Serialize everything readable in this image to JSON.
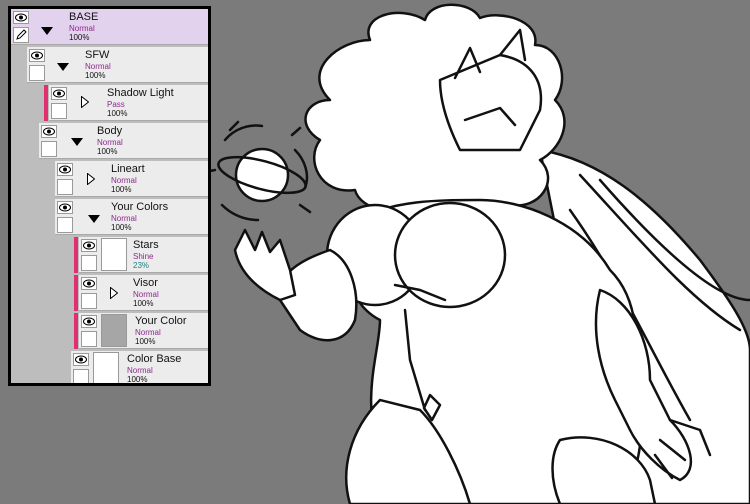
{
  "layers": [
    {
      "name": "BASE",
      "mode": "Normal",
      "opacity": "100%"
    },
    {
      "name": "SFW",
      "mode": "Normal",
      "opacity": "100%"
    },
    {
      "name": "Shadow Light",
      "mode": "Pass",
      "opacity": "100%"
    },
    {
      "name": "Body",
      "mode": "Normal",
      "opacity": "100%"
    },
    {
      "name": "Lineart",
      "mode": "Normal",
      "opacity": "100%"
    },
    {
      "name": "Your Colors",
      "mode": "Normal",
      "opacity": "100%"
    },
    {
      "name": "Stars",
      "mode": "Shine",
      "opacity": "23%"
    },
    {
      "name": "Visor",
      "mode": "Normal",
      "opacity": "100%"
    },
    {
      "name": "Your Color",
      "mode": "Normal",
      "opacity": "100%"
    },
    {
      "name": "Color Base",
      "mode": "Normal",
      "opacity": "100%"
    }
  ],
  "colors": {
    "canvas_background": "#7b7b7b",
    "selected_layer": "#e3d2ee",
    "clipping_stripe": "#e0306f",
    "blend_mode_text": "#8a2a8a"
  }
}
